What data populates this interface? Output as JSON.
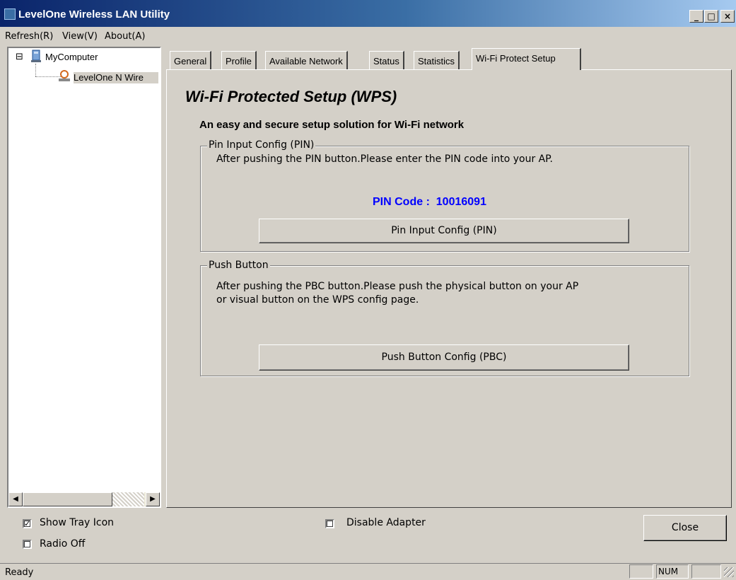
{
  "window": {
    "title": "LevelOne Wireless LAN Utility",
    "minimize_label": "_",
    "maximize_label": "□",
    "close_label": "×"
  },
  "menu": {
    "items": [
      {
        "label": "Refresh(R)",
        "accelerator": "R"
      },
      {
        "label": "View(V)",
        "accelerator": "V"
      },
      {
        "label": "About(A)",
        "accelerator": "A"
      }
    ]
  },
  "tree": {
    "root_label": "MyComputer",
    "expander": "⊟",
    "child_label": "LevelOne N Wire"
  },
  "tabs": [
    {
      "label": "General",
      "active": false
    },
    {
      "label": "Profile",
      "active": false
    },
    {
      "label": "Available Network",
      "active": false
    },
    {
      "label": "Status",
      "active": false
    },
    {
      "label": "Statistics",
      "active": false
    },
    {
      "label": "Wi-Fi Protect Setup",
      "active": true
    }
  ],
  "wps": {
    "title": "Wi-Fi Protected Setup (WPS)",
    "subtitle": "An easy and secure setup solution for Wi-Fi network",
    "pin_group": {
      "legend": "Pin Input Config (PIN)",
      "instruction": "After pushing the PIN button.Please enter the PIN code into your AP.",
      "pin_label": "PIN Code :",
      "pin_value": "10016091",
      "button_label": "Pin Input Config (PIN)"
    },
    "pbc_group": {
      "legend": "Push Button",
      "instruction_line1": "After pushing the PBC button.Please push the physical button on your AP",
      "instruction_line2": "or visual button on the WPS config page.",
      "button_label": "Push Button Config (PBC)"
    }
  },
  "options": {
    "show_tray_icon": {
      "label": "Show Tray Icon",
      "checked": true
    },
    "radio_off": {
      "label": "Radio Off",
      "checked": false
    },
    "disable_adapter": {
      "label": "Disable Adapter",
      "checked": false
    },
    "close_button": "Close"
  },
  "status": {
    "text": "Ready",
    "num_indicator": "NUM"
  },
  "colors": {
    "title_start": "#0a246a",
    "title_end": "#a6caf0",
    "face": "#d4d0c8",
    "pin_code": "#0000ff"
  }
}
